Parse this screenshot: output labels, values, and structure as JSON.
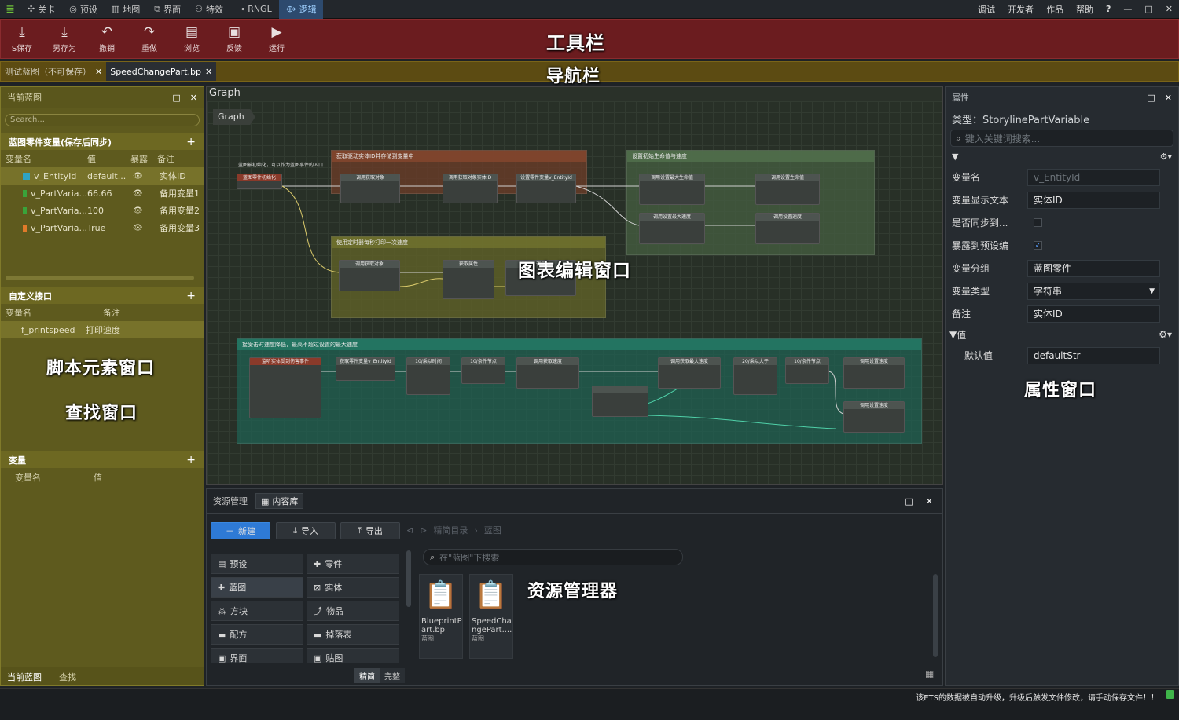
{
  "menubar": {
    "tabs": [
      {
        "icon": "compass-icon",
        "glyph": "✣",
        "label": "关卡"
      },
      {
        "icon": "preset-icon",
        "glyph": "◎",
        "label": "预设"
      },
      {
        "icon": "map-icon",
        "glyph": "▥",
        "label": "地图"
      },
      {
        "icon": "interface-icon",
        "glyph": "⧉",
        "label": "界面"
      },
      {
        "icon": "effects-icon",
        "glyph": "⚇",
        "label": "特效"
      },
      {
        "icon": "rngl-icon",
        "glyph": "⊸",
        "label": "RNGL"
      },
      {
        "icon": "logic-icon",
        "glyph": "⟴",
        "label": "逻辑"
      }
    ],
    "right_items": [
      "调试",
      "开发者",
      "作品",
      "帮助"
    ],
    "help_glyph": "?",
    "window_controls": [
      "—",
      "□",
      "✕"
    ]
  },
  "toolbar": {
    "buttons": [
      {
        "icon": "save-icon",
        "glyph": "⤓",
        "label": "S保存"
      },
      {
        "icon": "save-as-icon",
        "glyph": "⤓",
        "label": "另存为"
      },
      {
        "icon": "undo-icon",
        "glyph": "↶",
        "label": "撤销"
      },
      {
        "icon": "redo-icon",
        "glyph": "↷",
        "label": "重做"
      },
      {
        "icon": "browse-icon",
        "glyph": "▤",
        "label": "浏览"
      },
      {
        "icon": "feedback-icon",
        "glyph": "▣",
        "label": "反馈"
      },
      {
        "icon": "run-icon",
        "glyph": "▶",
        "label": "运行"
      }
    ],
    "annotation": "工具栏"
  },
  "navbar": {
    "tabs": [
      {
        "label": "测试蓝图（不可保存）",
        "close": "✕"
      },
      {
        "label": "SpeedChangePart.bp",
        "close": "✕"
      }
    ],
    "annotation": "导航栏"
  },
  "left_panel": {
    "title": "当前蓝图",
    "title_buttons": [
      "□",
      "✕"
    ],
    "search_placeholder": "Search...",
    "vars_section": "蓝图零件变量(保存后同步)",
    "plus": "+",
    "var_columns": [
      "变量名",
      "值",
      "暴露",
      "备注"
    ],
    "variables": [
      {
        "name": "v_EntityId",
        "value": "default...",
        "exposed": "👁",
        "note": "实体ID",
        "color": "#2fa3c4"
      },
      {
        "name": "v_PartVaria...",
        "value": "66.66",
        "exposed": "👁",
        "note": "备用变量1",
        "color": "#3aa33a"
      },
      {
        "name": "v_PartVaria...",
        "value": "100",
        "exposed": "👁",
        "note": "备用变量2",
        "color": "#3aa33a"
      },
      {
        "name": "v_PartVaria...",
        "value": "True",
        "exposed": "👁",
        "note": "备用变量3",
        "color": "#e07a2a"
      }
    ],
    "interface_section": "自定义接口",
    "interface_columns": [
      "变量名",
      "备注"
    ],
    "interfaces": [
      {
        "name": "f_printspeed",
        "note": "打印速度"
      }
    ],
    "annotation_script": "脚本元素窗口",
    "annotation_find": "查找窗口",
    "vars2_section": "变量",
    "vars2_columns": [
      "变量名",
      "值"
    ],
    "bottom_tabs": [
      "当前蓝图",
      "查找"
    ]
  },
  "graph": {
    "title": "Graph",
    "breadcrumb": "Graph",
    "annotation": "图表编辑窗口",
    "groups": [
      {
        "title": "获取驱动实体ID并存储到变量中",
        "color": "#6b3a2a"
      },
      {
        "title": "设置初始生命值与速度",
        "color": "#3a4c36"
      },
      {
        "title": "使用定时器每秒打印一次速度",
        "color": "#565a28"
      },
      {
        "title": "接受击时速度降低，最高不超过设置的最大速度",
        "color": "#1f5a4c"
      }
    ],
    "comment_1": "蓝图被初始化，可以作为蓝图事件的入口",
    "event_node": "蓝图零件初始化",
    "nodes_a": [
      "调用获取对象",
      "调用获取对象实体ID",
      "设置零件变量v_EntityId"
    ],
    "nodes_b": [
      "调用设置最大生命值",
      "调用设置生命值",
      "调用设置最大速度",
      "调用设置速度"
    ],
    "nodes_c": [
      "调用获取对象",
      "获取属性",
      "调用"
    ],
    "nodes_d": [
      "监听实体受到伤害事件",
      "获取零件变量v_EntityId",
      "10/乘以时间",
      "10/条件节点",
      "调用获取速度",
      "调用获取最大速度",
      "20/乘以大于",
      "10/条件节点",
      "调用设置速度",
      "调用设置速度"
    ]
  },
  "resource_manager": {
    "title": "资源管理",
    "tab": "内容库",
    "title_buttons": [
      "□",
      "✕"
    ],
    "buttons": [
      {
        "icon": "plus-icon",
        "glyph": "＋",
        "label": "新建"
      },
      {
        "icon": "import-icon",
        "glyph": "⤓",
        "label": "导入"
      },
      {
        "icon": "export-icon",
        "glyph": "⤒",
        "label": "导出"
      }
    ],
    "path": [
      "精简目录",
      "蓝图"
    ],
    "search_placeholder": "在\"蓝图\"下搜索",
    "categories": [
      {
        "icon": "preset-icon",
        "glyph": "▤",
        "label": "预设"
      },
      {
        "icon": "part-icon",
        "glyph": "✚",
        "label": "零件"
      },
      {
        "icon": "blueprint-icon",
        "glyph": "✚",
        "label": "蓝图"
      },
      {
        "icon": "entity-icon",
        "glyph": "⊠",
        "label": "实体"
      },
      {
        "icon": "block-icon",
        "glyph": "⁂",
        "label": "方块"
      },
      {
        "icon": "item-icon",
        "glyph": "⤴",
        "label": "物品"
      },
      {
        "icon": "recipe-icon",
        "glyph": "▬",
        "label": "配方"
      },
      {
        "icon": "loot-icon",
        "glyph": "▬",
        "label": "掉落表"
      },
      {
        "icon": "ui-icon",
        "glyph": "▣",
        "label": "界面"
      },
      {
        "icon": "texture-icon",
        "glyph": "▣",
        "label": "贴图"
      }
    ],
    "view_modes": [
      "精简",
      "完整"
    ],
    "assets": [
      {
        "name": "BlueprintPart.bp",
        "name_l1": "BlueprintP",
        "name_l2": "art.bp",
        "type": "蓝图"
      },
      {
        "name": "SpeedChangePart...",
        "name_l1": "SpeedCha",
        "name_l2": "ngePart....",
        "type": "蓝图"
      }
    ],
    "annotation": "资源管理器"
  },
  "properties": {
    "title": "属性",
    "title_buttons": [
      "□",
      "✕"
    ],
    "type_line": "类型：StorylinePartVariable",
    "search_placeholder": "键入关键词搜索...",
    "rows": [
      {
        "label": "变量名",
        "value": "v_EntityId"
      },
      {
        "label": "变量显示文本",
        "value": "实体ID"
      },
      {
        "label": "是否同步到...",
        "value": ""
      },
      {
        "label": "暴露到预设编",
        "value": "✓"
      },
      {
        "label": "变量分组",
        "value": "蓝图零件"
      },
      {
        "label": "变量类型",
        "value": "字符串"
      },
      {
        "label": "备注",
        "value": "实体ID"
      }
    ],
    "value_section": "值",
    "default_label": "默认值",
    "default_value": "defaultStr",
    "annotation": "属性窗口"
  },
  "status": {
    "message": "该ETS的数据被自动升级，升级后触发文件修改，请手动保存文件！！"
  }
}
